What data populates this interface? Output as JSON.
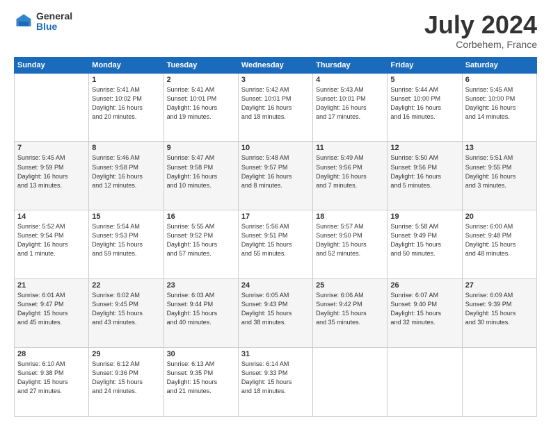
{
  "header": {
    "logo_general": "General",
    "logo_blue": "Blue",
    "month": "July 2024",
    "location": "Corbehem, France"
  },
  "weekdays": [
    "Sunday",
    "Monday",
    "Tuesday",
    "Wednesday",
    "Thursday",
    "Friday",
    "Saturday"
  ],
  "weeks": [
    [
      {
        "day": "",
        "info": ""
      },
      {
        "day": "1",
        "info": "Sunrise: 5:41 AM\nSunset: 10:02 PM\nDaylight: 16 hours\nand 20 minutes."
      },
      {
        "day": "2",
        "info": "Sunrise: 5:41 AM\nSunset: 10:01 PM\nDaylight: 16 hours\nand 19 minutes."
      },
      {
        "day": "3",
        "info": "Sunrise: 5:42 AM\nSunset: 10:01 PM\nDaylight: 16 hours\nand 18 minutes."
      },
      {
        "day": "4",
        "info": "Sunrise: 5:43 AM\nSunset: 10:01 PM\nDaylight: 16 hours\nand 17 minutes."
      },
      {
        "day": "5",
        "info": "Sunrise: 5:44 AM\nSunset: 10:00 PM\nDaylight: 16 hours\nand 16 minutes."
      },
      {
        "day": "6",
        "info": "Sunrise: 5:45 AM\nSunset: 10:00 PM\nDaylight: 16 hours\nand 14 minutes."
      }
    ],
    [
      {
        "day": "7",
        "info": "Sunrise: 5:45 AM\nSunset: 9:59 PM\nDaylight: 16 hours\nand 13 minutes."
      },
      {
        "day": "8",
        "info": "Sunrise: 5:46 AM\nSunset: 9:58 PM\nDaylight: 16 hours\nand 12 minutes."
      },
      {
        "day": "9",
        "info": "Sunrise: 5:47 AM\nSunset: 9:58 PM\nDaylight: 16 hours\nand 10 minutes."
      },
      {
        "day": "10",
        "info": "Sunrise: 5:48 AM\nSunset: 9:57 PM\nDaylight: 16 hours\nand 8 minutes."
      },
      {
        "day": "11",
        "info": "Sunrise: 5:49 AM\nSunset: 9:56 PM\nDaylight: 16 hours\nand 7 minutes."
      },
      {
        "day": "12",
        "info": "Sunrise: 5:50 AM\nSunset: 9:56 PM\nDaylight: 16 hours\nand 5 minutes."
      },
      {
        "day": "13",
        "info": "Sunrise: 5:51 AM\nSunset: 9:55 PM\nDaylight: 16 hours\nand 3 minutes."
      }
    ],
    [
      {
        "day": "14",
        "info": "Sunrise: 5:52 AM\nSunset: 9:54 PM\nDaylight: 16 hours\nand 1 minute."
      },
      {
        "day": "15",
        "info": "Sunrise: 5:54 AM\nSunset: 9:53 PM\nDaylight: 15 hours\nand 59 minutes."
      },
      {
        "day": "16",
        "info": "Sunrise: 5:55 AM\nSunset: 9:52 PM\nDaylight: 15 hours\nand 57 minutes."
      },
      {
        "day": "17",
        "info": "Sunrise: 5:56 AM\nSunset: 9:51 PM\nDaylight: 15 hours\nand 55 minutes."
      },
      {
        "day": "18",
        "info": "Sunrise: 5:57 AM\nSunset: 9:50 PM\nDaylight: 15 hours\nand 52 minutes."
      },
      {
        "day": "19",
        "info": "Sunrise: 5:58 AM\nSunset: 9:49 PM\nDaylight: 15 hours\nand 50 minutes."
      },
      {
        "day": "20",
        "info": "Sunrise: 6:00 AM\nSunset: 9:48 PM\nDaylight: 15 hours\nand 48 minutes."
      }
    ],
    [
      {
        "day": "21",
        "info": "Sunrise: 6:01 AM\nSunset: 9:47 PM\nDaylight: 15 hours\nand 45 minutes."
      },
      {
        "day": "22",
        "info": "Sunrise: 6:02 AM\nSunset: 9:45 PM\nDaylight: 15 hours\nand 43 minutes."
      },
      {
        "day": "23",
        "info": "Sunrise: 6:03 AM\nSunset: 9:44 PM\nDaylight: 15 hours\nand 40 minutes."
      },
      {
        "day": "24",
        "info": "Sunrise: 6:05 AM\nSunset: 9:43 PM\nDaylight: 15 hours\nand 38 minutes."
      },
      {
        "day": "25",
        "info": "Sunrise: 6:06 AM\nSunset: 9:42 PM\nDaylight: 15 hours\nand 35 minutes."
      },
      {
        "day": "26",
        "info": "Sunrise: 6:07 AM\nSunset: 9:40 PM\nDaylight: 15 hours\nand 32 minutes."
      },
      {
        "day": "27",
        "info": "Sunrise: 6:09 AM\nSunset: 9:39 PM\nDaylight: 15 hours\nand 30 minutes."
      }
    ],
    [
      {
        "day": "28",
        "info": "Sunrise: 6:10 AM\nSunset: 9:38 PM\nDaylight: 15 hours\nand 27 minutes."
      },
      {
        "day": "29",
        "info": "Sunrise: 6:12 AM\nSunset: 9:36 PM\nDaylight: 15 hours\nand 24 minutes."
      },
      {
        "day": "30",
        "info": "Sunrise: 6:13 AM\nSunset: 9:35 PM\nDaylight: 15 hours\nand 21 minutes."
      },
      {
        "day": "31",
        "info": "Sunrise: 6:14 AM\nSunset: 9:33 PM\nDaylight: 15 hours\nand 18 minutes."
      },
      {
        "day": "",
        "info": ""
      },
      {
        "day": "",
        "info": ""
      },
      {
        "day": "",
        "info": ""
      }
    ]
  ]
}
